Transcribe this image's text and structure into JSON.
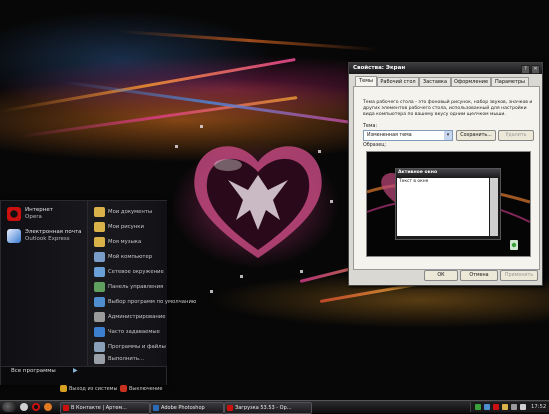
{
  "start_menu": {
    "pinned": [
      {
        "title": "Интернет",
        "subtitle": "Opera",
        "icon": "opera-icon",
        "color": "#cc1010"
      },
      {
        "title": "Электронная почта",
        "subtitle": "Outlook Express",
        "icon": "outlook-express-icon",
        "color": "#3b7bd0"
      }
    ],
    "places": [
      {
        "label": "Мои документы",
        "icon": "folder-icon",
        "color": "#d9b24a"
      },
      {
        "label": "Мои рисунки",
        "icon": "folder-icon",
        "color": "#d9b24a"
      },
      {
        "label": "Моя музыка",
        "icon": "folder-icon",
        "color": "#d9b24a"
      },
      {
        "label": "Мой компьютер",
        "icon": "computer-icon",
        "color": "#7a9cc8"
      },
      {
        "label": "Сетевое окружение",
        "icon": "network-icon",
        "color": "#6aa0d8"
      },
      {
        "label": "Панель управления",
        "icon": "control-panel-icon",
        "color": "#5fa05f"
      },
      {
        "label": "Выбор программ по умолчанию",
        "icon": "default-programs-icon",
        "color": "#4f8fcf"
      },
      {
        "label": "Администрирование",
        "icon": "admin-tools-icon",
        "color": "#9a9a9a"
      },
      {
        "label": "Часто задаваемые",
        "icon": "help-icon",
        "color": "#3c7fd0"
      },
      {
        "label": "Программы и файлы",
        "icon": "search-icon",
        "color": "#8aa0b8"
      },
      {
        "label": "Выполнить...",
        "icon": "run-icon",
        "color": "#9aa0a8"
      }
    ],
    "all_programs": "Все программы",
    "logoff": "Выход из системы",
    "shutdown": "Выключение"
  },
  "dialog": {
    "title": "Свойства: Экран",
    "tabs": [
      "Темы",
      "Рабочий стол",
      "Заставка",
      "Оформление",
      "Параметры"
    ],
    "active_tab": "Темы",
    "description": "Тема рабочего стола - это фоновый рисунок, набор звуков, значков и других элементов рабочего стола, использованный для настройки вида компьютера по вашему вкусу одним щелчком мыши.",
    "theme_label": "Тема:",
    "theme_value": "Измененная тема",
    "save_button": "Сохранить...",
    "delete_button": "Удалить",
    "preview_label": "Образец:",
    "preview_window_title": "Активное окно",
    "preview_window_text": "Текст в окне",
    "ok": "ОК",
    "cancel": "Отмена",
    "apply": "Применить"
  },
  "taskbar": {
    "quick_launch": [
      {
        "icon": "show-desktop-icon",
        "color": "#cfcfcf"
      },
      {
        "icon": "opera-icon",
        "color": "#cc1010"
      },
      {
        "icon": "media-player-icon",
        "color": "#e07a20"
      }
    ],
    "tasks": [
      {
        "label": "В Контакте | Артем...",
        "icon": "opera-icon",
        "color": "#cc1010"
      },
      {
        "label": "Adobe Photoshop",
        "icon": "photoshop-icon",
        "color": "#2d6cb5"
      },
      {
        "label": "Загрузка 53.53 - Ор...",
        "icon": "opera-icon",
        "color": "#cc1010"
      }
    ],
    "clock": "17:52"
  }
}
